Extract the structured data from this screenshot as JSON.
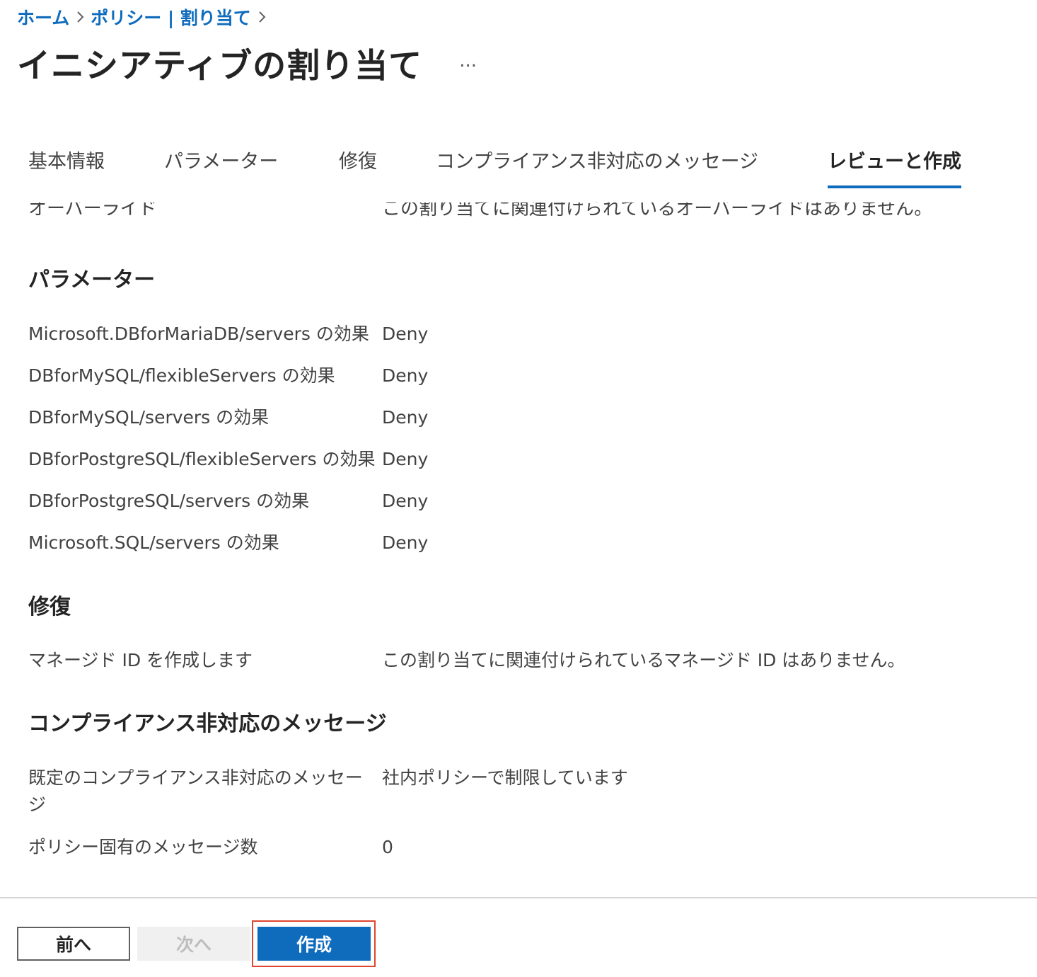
{
  "breadcrumb": {
    "items": [
      "ホーム",
      "ポリシー | 割り当て"
    ]
  },
  "header": {
    "title": "イニシアティブの割り当て",
    "more_label": "..."
  },
  "tabs": [
    {
      "label": "基本情報",
      "active": false
    },
    {
      "label": "パラメーター",
      "active": false
    },
    {
      "label": "修復",
      "active": false
    },
    {
      "label": "コンプライアンス非対応のメッセージ",
      "active": false
    },
    {
      "label": "レビューと作成",
      "active": true
    }
  ],
  "review": {
    "cut_row": {
      "key": "オーバーライド",
      "value": "この割り当てに関連付けられているオーバーライドはありません。"
    },
    "parameters": {
      "title": "パラメーター",
      "rows": [
        {
          "key": "Microsoft.DBforMariaDB/servers の効果",
          "value": "Deny"
        },
        {
          "key": "DBforMySQL/flexibleServers の効果",
          "value": "Deny"
        },
        {
          "key": "DBforMySQL/servers の効果",
          "value": "Deny"
        },
        {
          "key": "DBforPostgreSQL/flexibleServers の効果",
          "value": "Deny"
        },
        {
          "key": "DBforPostgreSQL/servers の効果",
          "value": "Deny"
        },
        {
          "key": "Microsoft.SQL/servers の効果",
          "value": "Deny"
        }
      ]
    },
    "remediation": {
      "title": "修復",
      "rows": [
        {
          "key": "マネージド ID を作成します",
          "value": "この割り当てに関連付けられているマネージド ID はありません。"
        }
      ]
    },
    "noncompliance": {
      "title": "コンプライアンス非対応のメッセージ",
      "rows": [
        {
          "key": "既定のコンプライアンス非対応のメッセージ",
          "value": "社内ポリシーで制限しています"
        },
        {
          "key": "ポリシー固有のメッセージ数",
          "value": "0"
        }
      ]
    }
  },
  "footer": {
    "prev_label": "前へ",
    "next_label": "次へ",
    "create_label": "作成"
  },
  "colors": {
    "accent": "#0f6cbd",
    "highlight_frame": "#e0452e"
  }
}
